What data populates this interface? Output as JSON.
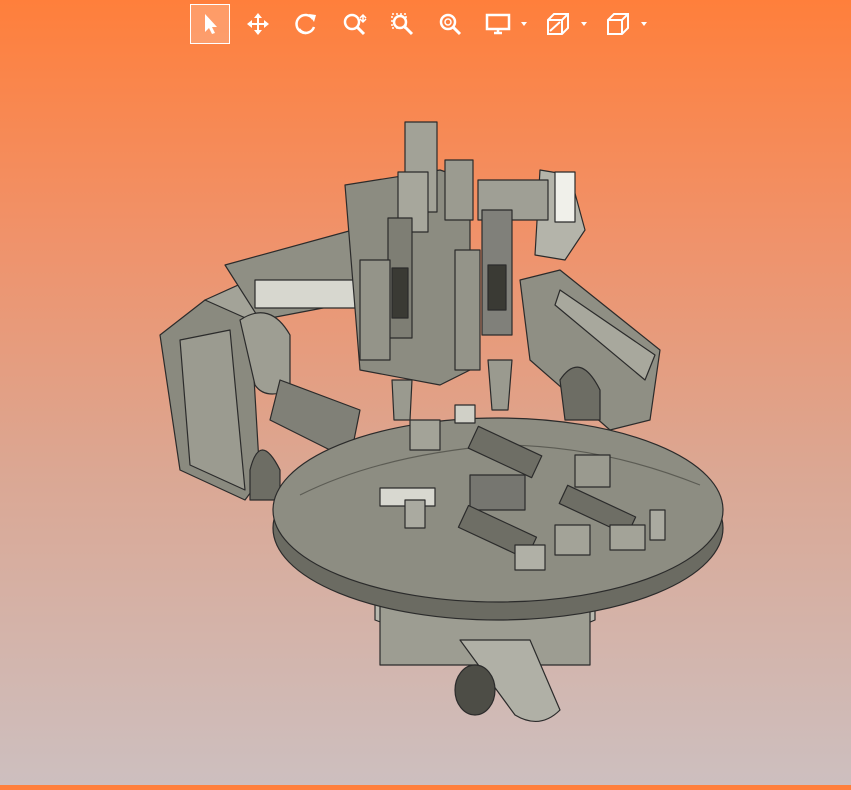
{
  "toolbar": {
    "tools": [
      {
        "id": "select",
        "icon": "cursor-arrow-icon",
        "active": true
      },
      {
        "id": "pan",
        "icon": "move-arrows-icon",
        "active": false
      },
      {
        "id": "rotate",
        "icon": "rotate-icon",
        "active": false
      },
      {
        "id": "zoom",
        "icon": "zoom-icon",
        "active": false
      },
      {
        "id": "zoom-area",
        "icon": "zoom-window-icon",
        "active": false
      },
      {
        "id": "zoom-fit",
        "icon": "zoom-fit-icon",
        "active": false
      },
      {
        "id": "display",
        "icon": "monitor-icon",
        "dropdown": true
      },
      {
        "id": "section",
        "icon": "section-view-icon",
        "dropdown": true
      },
      {
        "id": "views",
        "icon": "cube-view-icon",
        "dropdown": true
      }
    ]
  },
  "colors": {
    "background_top": "#ff7f3b",
    "background_bottom": "#cdbfbf",
    "icon": "#ffffff",
    "model_body": "#8f8f84",
    "model_edges": "#2b2b2b"
  }
}
